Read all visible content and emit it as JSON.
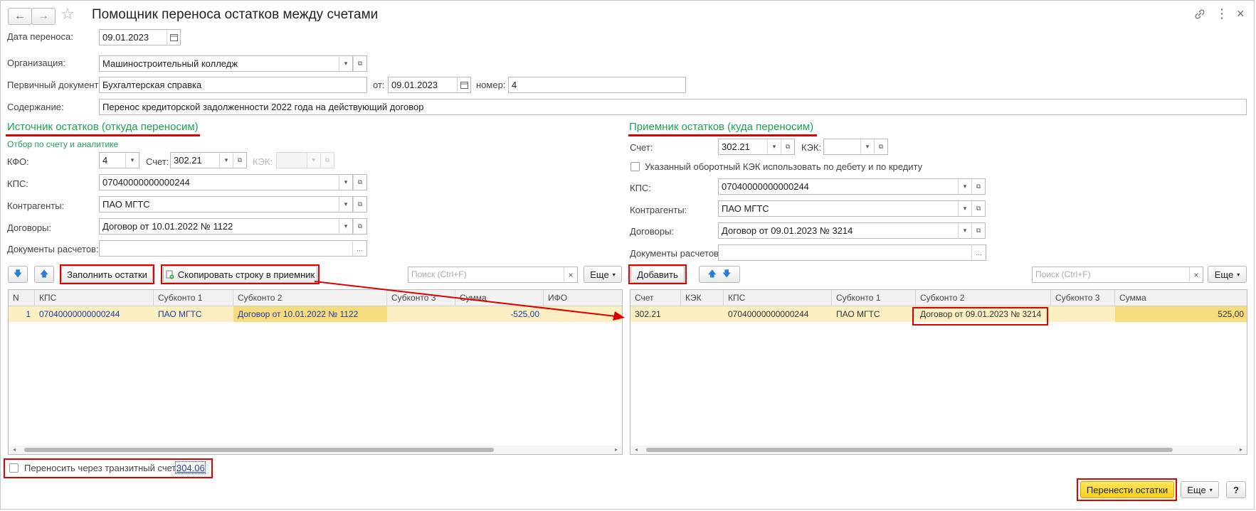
{
  "window": {
    "title": "Помощник переноса остатков между счетами",
    "back_icon": "←",
    "forward_icon": "→",
    "star_icon": "☆",
    "link_icon": "🔗",
    "more_icon": "⋮",
    "close_icon": "×"
  },
  "header_fields": {
    "date_label": "Дата переноса:",
    "date_value": "09.01.2023",
    "org_label": "Организация:",
    "org_value": "Машиностроительный колледж",
    "primary_doc_label": "Первичный документ:",
    "primary_doc_value": "Бухгалтерская справка",
    "from_label": "от:",
    "from_value": "09.01.2023",
    "number_label": "номер:",
    "number_value": "4",
    "content_label": "Содержание:",
    "content_value": "Перенос кредиторской задолженности 2022 года на действующий договор"
  },
  "source": {
    "title": "Источник остатков (откуда переносим)",
    "filter_subtitle": "Отбор по счету и аналитике",
    "kfo_label": "КФО:",
    "kfo_value": "4",
    "account_label": "Счет:",
    "account_value": "302.21",
    "kek_label": "КЭК:",
    "kek_value": "",
    "kps_label": "КПС:",
    "kps_value": "07040000000000244",
    "counterparties_label": "Контрагенты:",
    "counterparties_value": "ПАО МГТС",
    "contracts_label": "Договоры:",
    "contracts_value": "Договор от 10.01.2022 № 1122",
    "settlement_docs_label": "Документы расчетов:",
    "settlement_docs_value": "",
    "fill_button": "Заполнить остатки",
    "copy_button": "Скопировать строку в приемник",
    "search_placeholder": "Поиск (Ctrl+F)",
    "more_button": "Еще",
    "columns": [
      "N",
      "КПС",
      "Субконто 1",
      "Субконто 2",
      "Субконто 3",
      "Сумма",
      "ИФО"
    ],
    "rows": [
      {
        "n": "1",
        "kps": "07040000000000244",
        "sub1": "ПАО МГТС",
        "sub2": "Договор от 10.01.2022 № 1122",
        "sub3": "",
        "sum": "-525,00",
        "ifo": ""
      }
    ]
  },
  "receiver": {
    "title": "Приемник остатков (куда переносим)",
    "account_label": "Счет:",
    "account_value": "302.21",
    "kek_label": "КЭК:",
    "kek_value": "",
    "kek_checkbox_label": "Указанный оборотный КЭК использовать по дебету и по кредиту",
    "kps_label": "КПС:",
    "kps_value": "07040000000000244",
    "counterparties_label": "Контрагенты:",
    "counterparties_value": "ПАО МГТС",
    "contracts_label": "Договоры:",
    "contracts_value": "Договор от 09.01.2023 № 3214",
    "settlement_docs_label": "Документы расчетов:",
    "settlement_docs_value": "",
    "add_button": "Добавить",
    "search_placeholder": "Поиск (Ctrl+F)",
    "more_button": "Еще",
    "columns": [
      "Счет",
      "КЭК",
      "КПС",
      "Субконто 1",
      "Субконто 2",
      "Субконто 3",
      "Сумма"
    ],
    "rows": [
      {
        "account": "302.21",
        "kek": "",
        "kps": "07040000000000244",
        "sub1": "ПАО МГТС",
        "sub2": "Договор от 09.01.2023 № 3214",
        "sub3": "",
        "sum": "525,00"
      }
    ]
  },
  "footer": {
    "transit_label": "Переносить через транзитный счет:",
    "transit_account": "304.06",
    "transfer_button": "Перенести остатки",
    "more_button": "Еще",
    "help_button": "?"
  },
  "colors": {
    "accent_green": "#1aa355",
    "highlight_red": "#e00000",
    "row_highlight": "#fcf0c3",
    "primary_yellow": "#f6cf1d"
  }
}
